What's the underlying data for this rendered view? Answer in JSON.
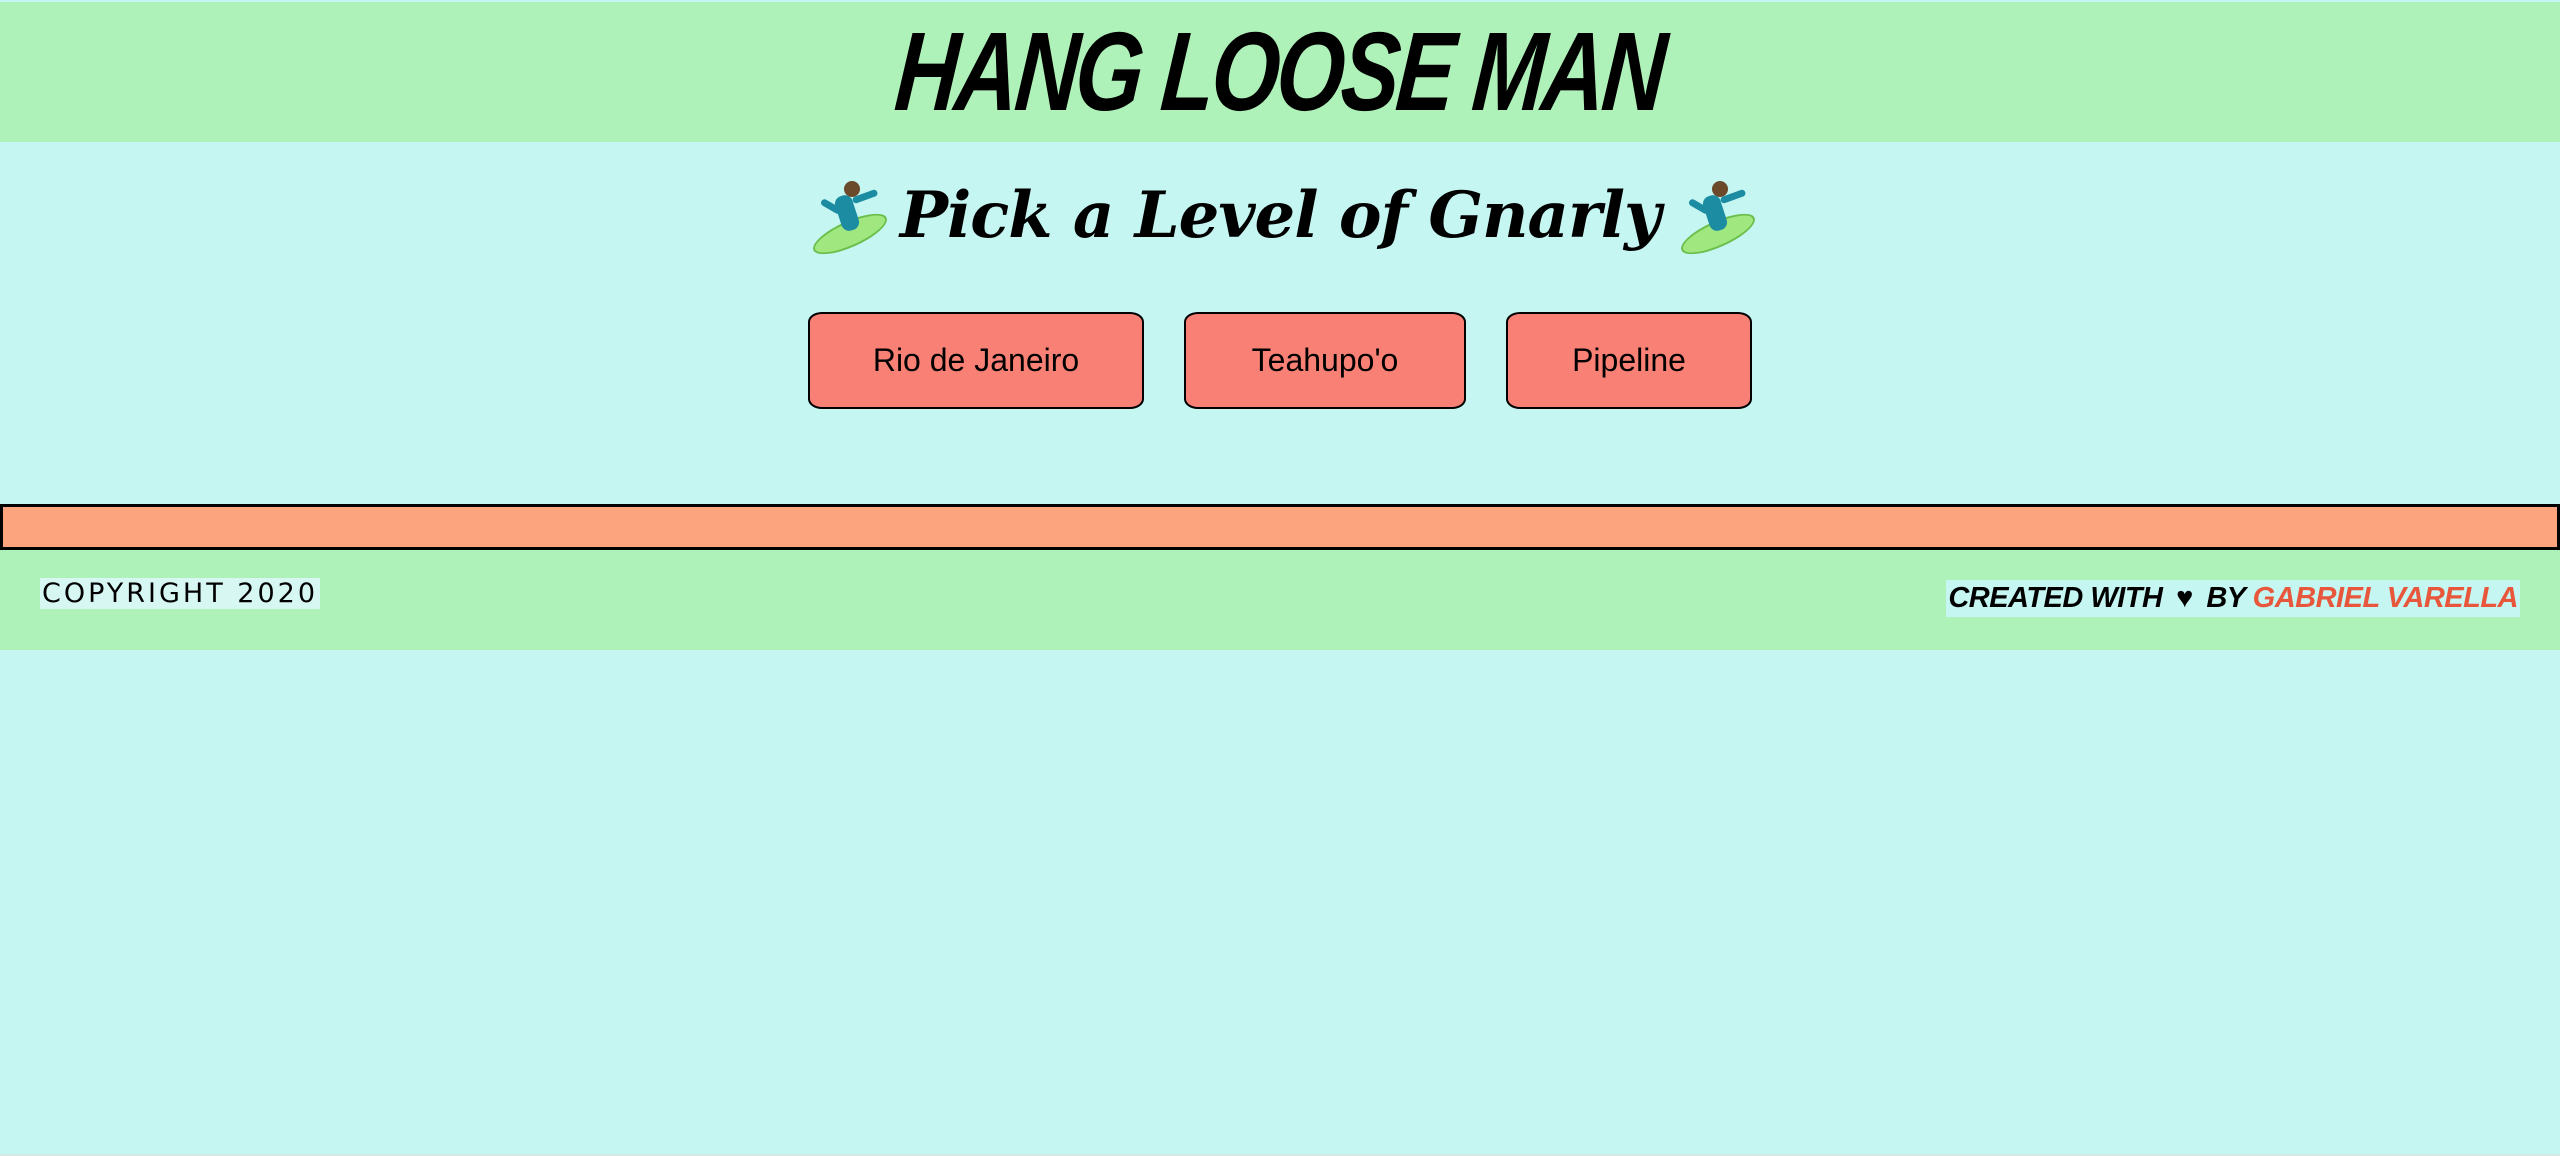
{
  "header": {
    "title": "HANG LOOSE MAN"
  },
  "main": {
    "subtitle": "Pick a Level of Gnarly",
    "levels": [
      {
        "label": "Rio de Janeiro"
      },
      {
        "label": "Teahupo'o"
      },
      {
        "label": "Pipeline"
      }
    ]
  },
  "footer": {
    "copyright": "COPYRIGHT 2020",
    "credit_prefix": "CREATED WITH",
    "credit_heart": "♥",
    "credit_by": "BY",
    "credit_author": "GABRIEL VARELLA"
  },
  "colors": {
    "background": "#c5f6f2",
    "header_bg": "#aff2b9",
    "button_bg": "#f88074",
    "result_bar_bg": "#fba47e",
    "author_accent": "#e8573b"
  },
  "icons": {
    "surfer": "person-surfing-icon"
  }
}
